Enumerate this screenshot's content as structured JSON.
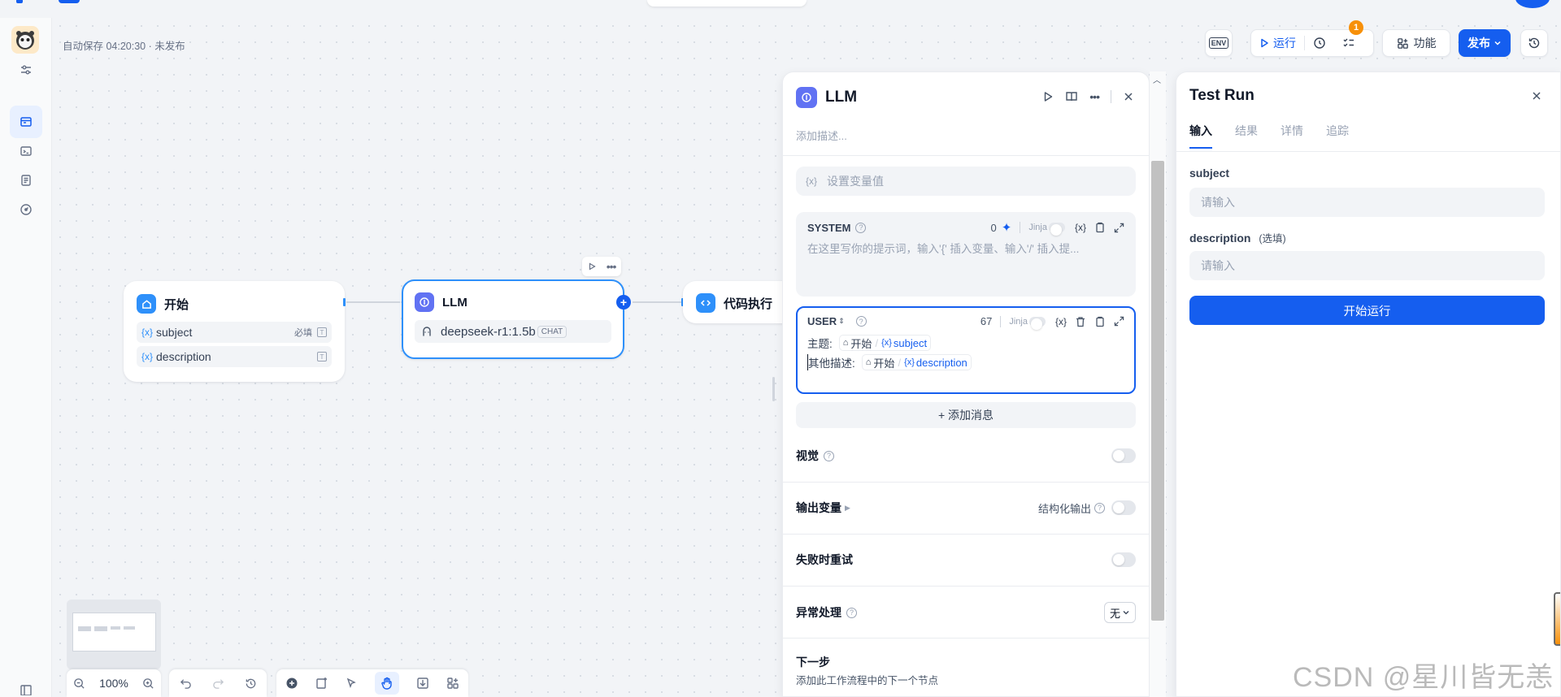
{
  "canvas": {
    "autosave": "自动保存 04:20:30 · 未发布"
  },
  "toolbar": {
    "env": "ENV",
    "run": "运行",
    "badge": "1",
    "features": "功能",
    "publish": "发布"
  },
  "nodes": {
    "start": {
      "title": "开始",
      "vars": [
        {
          "name": "subject",
          "tag": "必填"
        },
        {
          "name": "description",
          "tag": ""
        }
      ]
    },
    "llm": {
      "title": "LLM",
      "model": "deepseek-r1:1.5b",
      "mode": "CHAT"
    },
    "code": {
      "title": "代码执行"
    }
  },
  "zoom": "100%",
  "llm_panel": {
    "title": "LLM",
    "desc_placeholder": "添加描述...",
    "context_placeholder": "设置变量值",
    "system": {
      "label": "SYSTEM",
      "count": "0",
      "jinja": "Jinja",
      "placeholder": "在这里写你的提示词，输入'{' 插入变量、输入'/' 插入提..."
    },
    "user": {
      "label": "USER",
      "count": "67",
      "jinja": "Jinja",
      "line1_label": "主题:",
      "line2_label": "其他描述:",
      "source": "开始",
      "var1": "subject",
      "var2": "description"
    },
    "add_message": "+ 添加消息",
    "vision": "视觉",
    "output_vars": "输出变量",
    "structured_output": "结构化输出",
    "retry": "失败时重试",
    "error_handling": "异常处理",
    "error_value": "无",
    "next_step": "下一步",
    "next_step_desc": "添加此工作流程中的下一个节点"
  },
  "test_run": {
    "title": "Test Run",
    "tabs": [
      "输入",
      "结果",
      "详情",
      "追踪"
    ],
    "fields": [
      {
        "label": "subject",
        "optional": "",
        "placeholder": "请输入"
      },
      {
        "label": "description",
        "optional": "(选填)",
        "placeholder": "请输入"
      }
    ],
    "run_button": "开始运行"
  },
  "watermark": "CSDN @星川皆无恙"
}
